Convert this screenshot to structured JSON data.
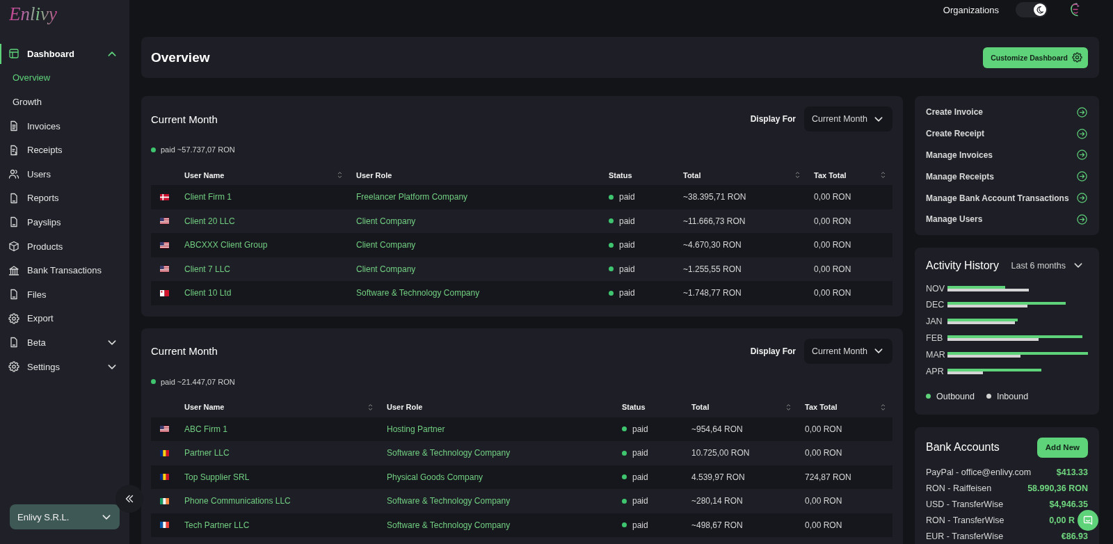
{
  "sidebar": {
    "logo": "Enlivy",
    "items": [
      {
        "kind": "group",
        "label": "Dashboard",
        "selected": true,
        "expanded": true,
        "children": [
          {
            "label": "Overview",
            "selected": true
          },
          {
            "label": "Growth",
            "selected": false
          }
        ]
      },
      {
        "kind": "link",
        "label": "Invoices",
        "selected": false
      },
      {
        "kind": "link",
        "label": "Receipts",
        "selected": false
      },
      {
        "kind": "link",
        "label": "Users",
        "selected": false
      },
      {
        "kind": "link",
        "label": "Reports",
        "selected": false
      },
      {
        "kind": "link",
        "label": "Payslips",
        "selected": false
      },
      {
        "kind": "link",
        "label": "Products",
        "selected": false
      },
      {
        "kind": "link",
        "label": "Bank Transactions",
        "selected": false
      },
      {
        "kind": "link",
        "label": "Files",
        "selected": false
      },
      {
        "kind": "link",
        "label": "Export",
        "selected": false
      },
      {
        "kind": "group",
        "label": "Beta",
        "selected": false,
        "expanded": false
      },
      {
        "kind": "group",
        "label": "Settings",
        "selected": false,
        "expanded": false
      }
    ],
    "organization": "Enlivy S.R.L."
  },
  "topbar": {
    "organizations": "Organizations",
    "dark_mode": {
      "on": true
    }
  },
  "page_header": {
    "title": "Overview",
    "button": "Customize Dashboard"
  },
  "reports": [
    {
      "title": "Current Month",
      "display_for": {
        "label": "Display For",
        "value": "Current Month"
      },
      "summary": "paid ~57.737,07 RON",
      "columns": [
        {
          "label": "User Name",
          "sortable": true
        },
        {
          "label": "User Role",
          "sortable": false
        },
        {
          "label": "Status",
          "sortable": false
        },
        {
          "label": "Total",
          "sortable": true
        },
        {
          "label": "Tax Total",
          "sortable": true
        }
      ],
      "rows": [
        {
          "user_name": "Client Firm 1",
          "user_role": "Freelancer Platform Company",
          "status": "paid",
          "total": "~38.395,71 RON",
          "tax_total": "0,00 RON"
        },
        {
          "user_name": "Client 20 LLC",
          "user_role": "Client Company",
          "status": "paid",
          "total": "~11.666,73 RON",
          "tax_total": "0,00 RON"
        },
        {
          "user_name": "ABCXXX Client Group",
          "user_role": "Client Company",
          "status": "paid",
          "total": "~4.670,30 RON",
          "tax_total": "0,00 RON"
        },
        {
          "user_name": "Client 7 LLC",
          "user_role": "Client Company",
          "status": "paid",
          "total": "~1.255,55 RON",
          "tax_total": "0,00 RON"
        },
        {
          "user_name": "Client 10 Ltd",
          "user_role": "Software & Technology Company",
          "status": "paid",
          "total": "~1.748,77 RON",
          "tax_total": "0,00 RON"
        }
      ]
    },
    {
      "title": "Current Month",
      "display_for": {
        "label": "Display For",
        "value": "Current Month"
      },
      "summary": "paid ~21.447,07 RON",
      "columns": [
        {
          "label": "User Name",
          "sortable": true
        },
        {
          "label": "User Role",
          "sortable": false
        },
        {
          "label": "Status",
          "sortable": false
        },
        {
          "label": "Total",
          "sortable": true
        },
        {
          "label": "Tax Total",
          "sortable": true
        }
      ],
      "rows": [
        {
          "user_name": "ABC Firm 1",
          "user_role": "Hosting Partner",
          "status": "paid",
          "total": "~954,64 RON",
          "tax_total": "0,00 RON"
        },
        {
          "user_name": "Partner LLC",
          "user_role": "Software & Technology Company",
          "status": "paid",
          "total": "10.725,00 RON",
          "tax_total": "0,00 RON"
        },
        {
          "user_name": "Top Supplier SRL",
          "user_role": "Physical Goods Company",
          "status": "paid",
          "total": "4.539,97 RON",
          "tax_total": "724,87 RON"
        },
        {
          "user_name": "Phone Communications LLC",
          "user_role": "Software & Technology Company",
          "status": "paid",
          "total": "~280,14 RON",
          "tax_total": "0,00 RON"
        },
        {
          "user_name": "Tech Partner LLC",
          "user_role": "Software & Technology Company",
          "status": "paid",
          "total": "~498,67 RON",
          "tax_total": "0,00 RON"
        }
      ]
    }
  ],
  "quick_links": [
    "Create Invoice",
    "Create Receipt",
    "Manage Invoices",
    "Manage Receipts",
    "Manage Bank Account Transactions",
    "Manage Users"
  ],
  "activity_history": {
    "title": "Activity History",
    "period": "Last 6 months",
    "months": [
      "NOV",
      "DEC",
      "JAN",
      "FEB",
      "MAR",
      "APR"
    ],
    "legend": [
      {
        "label": "Outbound",
        "color": "#5fd37a"
      },
      {
        "label": "Inbound",
        "color": "#d4d4d4"
      }
    ]
  },
  "bank_accounts": {
    "title": "Bank Accounts",
    "button": "Add New",
    "accounts": [
      {
        "name": "PayPal - office@enlivy.com",
        "amount": "$413.33"
      },
      {
        "name": "RON - Raiffeisen",
        "amount": "58.990,36 RON"
      },
      {
        "name": "USD - TransferWise",
        "amount": "$4,946.35"
      },
      {
        "name": "RON - TransferWise",
        "amount": "0,00 R"
      },
      {
        "name": "EUR - TransferWise",
        "amount": "€86.93"
      }
    ]
  }
}
